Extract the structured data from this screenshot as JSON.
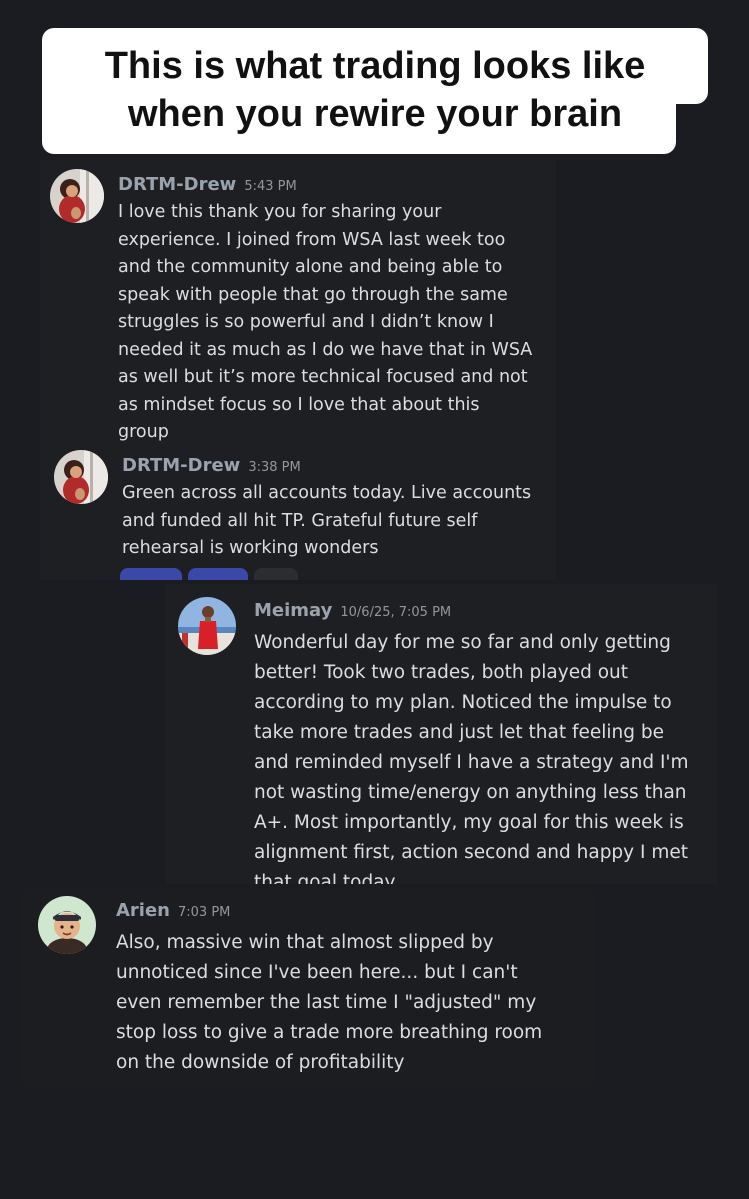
{
  "headline": {
    "line1": "This is what trading looks like",
    "line2": "when you rewire your brain"
  },
  "card1": {
    "messages": [
      {
        "username": "DRTM-Drew",
        "time": "5:43 PM",
        "text": "I love this thank you for sharing your\nexperience. I joined from WSA last week too\nand the community alone and being able to\nspeak with people that go through the same\nstruggles is so powerful and I didn’t know I\nneeded it as much as I do we have that in WSA\nas well but it’s more technical focused and not\nas mindset focus so I love that about this\ngroup"
      },
      {
        "username": "DRTM-Drew",
        "time": "3:38 PM",
        "text": "Green across all accounts today. Live accounts\nand funded all hit TP. Grateful future self\nrehearsal is working wonders"
      }
    ]
  },
  "card2": {
    "username": "Meimay",
    "time": "10/6/25, 7:05 PM",
    "text": "Wonderful day for me so far and only getting\nbetter!  Took two trades, both played out\naccording to my plan.  Noticed the impulse to\ntake more trades and just let that feeling be\nand reminded myself I have a strategy and I'm\nnot wasting time/energy on anything less than\nA+.  Most importantly, my goal for this week is\nalignment first, action second and happy I met\nthat goal today"
  },
  "card3": {
    "username": "Arien",
    "time": "7:03 PM",
    "text": "Also, massive win that almost slipped by\nunnoticed since I've been here... but I can't\neven remember the last time I \"adjusted\" my\nstop loss to give a trade more breathing room\non the downside of profitability"
  },
  "colors": {
    "page_background": "#1b1b22",
    "card_background": "#1e1f22",
    "username": "#9aa3ad",
    "message_text": "#dbdee1",
    "reaction_active": "#3a49a8"
  }
}
